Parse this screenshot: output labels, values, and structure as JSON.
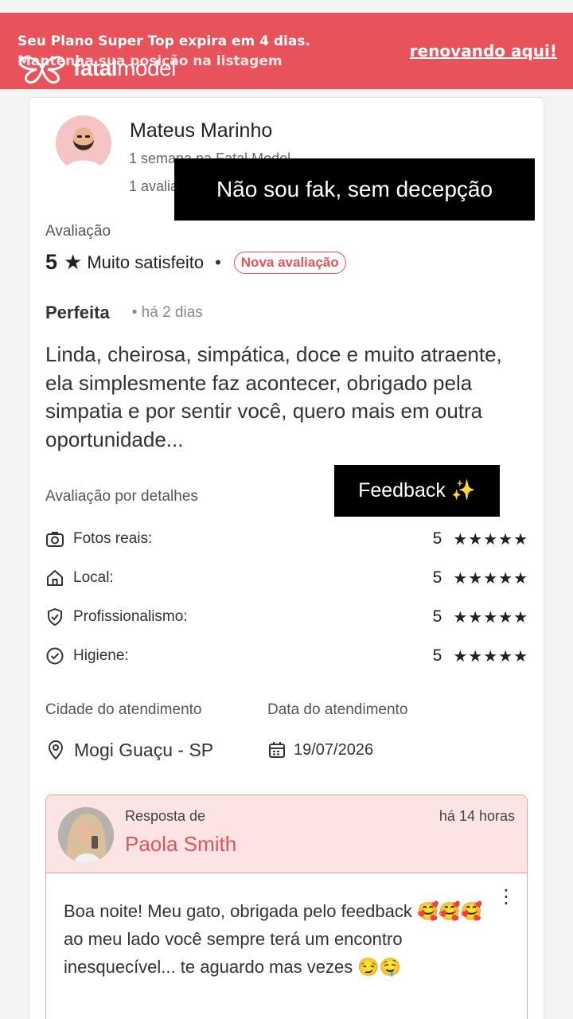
{
  "banner": {
    "line1": "Seu Plano Super Top expira em 4 dias.",
    "line2": "Mantenha sua posição na listagem",
    "link": "renovando aqui!",
    "color": "#e8525a"
  },
  "logo": {
    "text_bold": "fatal",
    "text_regular": "model"
  },
  "reviewer": {
    "name": "Mateus Marinho",
    "meta1": "1 semana na Fatal Model",
    "meta2": "1 avaliação"
  },
  "overlays": {
    "caption1": "Não sou fak, sem decepção",
    "caption2": "Feedback ✨"
  },
  "rating": {
    "section_label": "Avaliação",
    "score": "5",
    "text": "Muito satisfeito",
    "badge": "Nova avaliação"
  },
  "review": {
    "title": "Perfeita",
    "when": "há 2 dias",
    "body": "Linda, cheirosa, simpática, doce e muito atraente, ela simplesmente faz acontecer, obrigado pela simpatia e por sentir você, quero mais em outra oportunidade..."
  },
  "details": {
    "label": "Avaliação por detalhes",
    "items": [
      {
        "icon": "camera-icon",
        "label": "Fotos reais:",
        "score": "5",
        "stars": "★★★★★"
      },
      {
        "icon": "home-icon",
        "label": "Local:",
        "score": "5",
        "stars": "★★★★★"
      },
      {
        "icon": "shield-check-icon",
        "label": "Profissionalismo:",
        "score": "5",
        "stars": "★★★★★"
      },
      {
        "icon": "check-circle-icon",
        "label": "Higiene:",
        "score": "5",
        "stars": "★★★★★"
      }
    ]
  },
  "service": {
    "city_label": "Cidade do atendimento",
    "city": "Mogi Guaçu - SP",
    "date_label": "Data do atendimento",
    "date": "19/07/2026"
  },
  "reply": {
    "from_label": "Resposta de",
    "name": "Paola Smith",
    "when": "há 14 horas",
    "body": "Boa noite! Meu gato, obrigada pelo feedback 🥰🥰🥰 ao meu lado você sempre terá um encontro inesquecível... te aguardo mas vezes 😏🤤",
    "accent": "#e8525a"
  }
}
